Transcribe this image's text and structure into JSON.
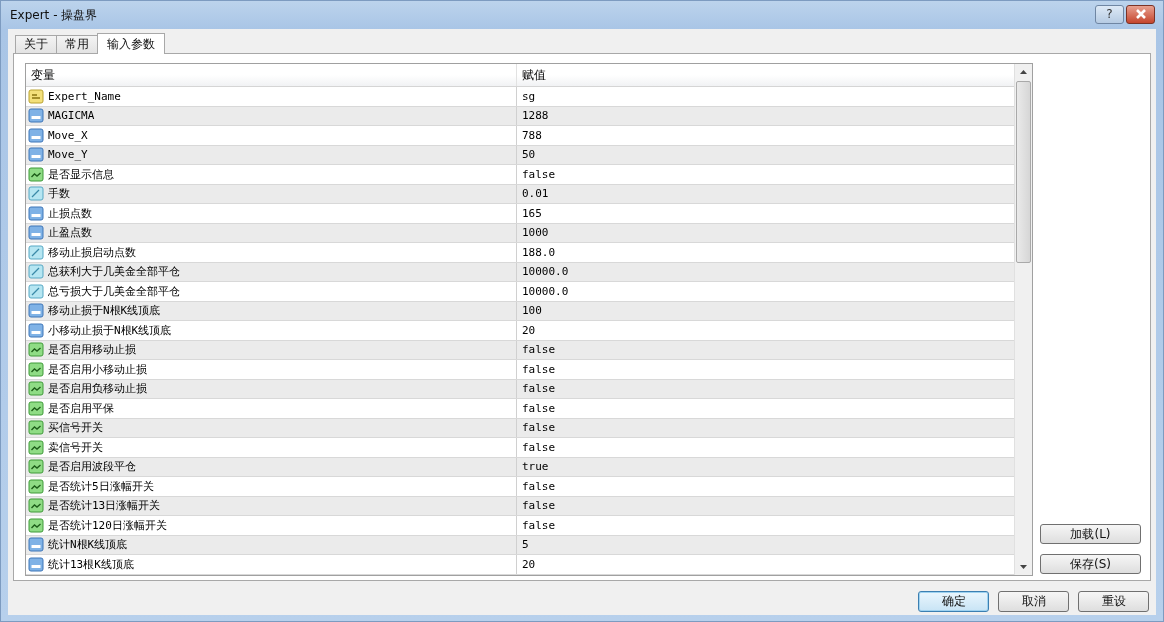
{
  "window": {
    "title": "Expert - 操盘界",
    "help": "?"
  },
  "tabs": [
    {
      "label": "关于",
      "selected": false
    },
    {
      "label": "常用",
      "selected": false
    },
    {
      "label": "输入参数",
      "selected": true
    }
  ],
  "table": {
    "columns": [
      "变量",
      "赋值"
    ],
    "rows": [
      {
        "kind": "string",
        "name": "Expert_Name",
        "value": "sg"
      },
      {
        "kind": "int",
        "name": "MAGICMA",
        "value": "1288"
      },
      {
        "kind": "int",
        "name": "Move_X",
        "value": "788"
      },
      {
        "kind": "int",
        "name": "Move_Y",
        "value": "50"
      },
      {
        "kind": "bool",
        "name": "是否显示信息",
        "value": "false"
      },
      {
        "kind": "double",
        "name": "手数",
        "value": "0.01"
      },
      {
        "kind": "int",
        "name": "止损点数",
        "value": "165"
      },
      {
        "kind": "int",
        "name": "止盈点数",
        "value": "1000"
      },
      {
        "kind": "double",
        "name": "移动止损启动点数",
        "value": "188.0"
      },
      {
        "kind": "double",
        "name": "总获利大于几美金全部平仓",
        "value": "10000.0"
      },
      {
        "kind": "double",
        "name": "总亏损大于几美金全部平仓",
        "value": "10000.0"
      },
      {
        "kind": "int",
        "name": "移动止损于N根K线顶底",
        "value": "100"
      },
      {
        "kind": "int",
        "name": "小移动止损于N根K线顶底",
        "value": "20"
      },
      {
        "kind": "bool",
        "name": "是否启用移动止损",
        "value": "false"
      },
      {
        "kind": "bool",
        "name": "是否启用小移动止损",
        "value": "false"
      },
      {
        "kind": "bool",
        "name": "是否启用负移动止损",
        "value": "false"
      },
      {
        "kind": "bool",
        "name": "是否启用平保",
        "value": "false"
      },
      {
        "kind": "bool",
        "name": "买信号开关",
        "value": "false"
      },
      {
        "kind": "bool",
        "name": "卖信号开关",
        "value": "false"
      },
      {
        "kind": "bool",
        "name": "是否启用波段平仓",
        "value": "true"
      },
      {
        "kind": "bool",
        "name": "是否统计5日涨幅开关",
        "value": "false"
      },
      {
        "kind": "bool",
        "name": "是否统计13日涨幅开关",
        "value": "false"
      },
      {
        "kind": "bool",
        "name": "是否统计120日涨幅开关",
        "value": "false"
      },
      {
        "kind": "int",
        "name": "统计N根K线顶底",
        "value": "5"
      },
      {
        "kind": "int",
        "name": "统计13根K线顶底",
        "value": "20"
      }
    ]
  },
  "side_buttons": [
    "加载(L)",
    "保存(S)"
  ],
  "buttons": [
    {
      "label": "确定",
      "default": true
    },
    {
      "label": "取消",
      "default": false
    },
    {
      "label": "重设",
      "default": false
    }
  ]
}
